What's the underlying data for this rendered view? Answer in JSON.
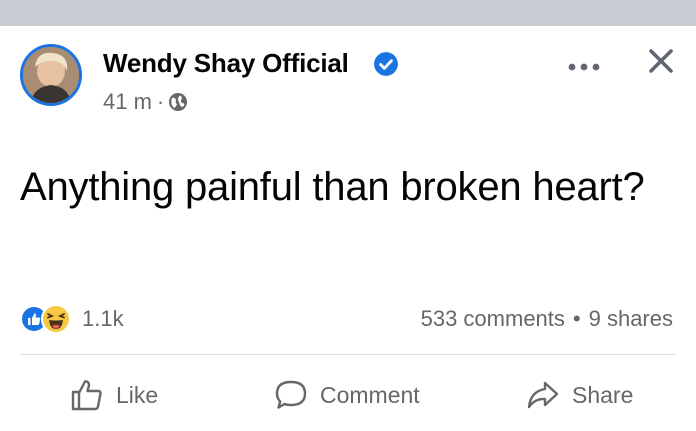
{
  "post": {
    "author": "Wendy Shay Official",
    "time": "41 m",
    "separator": "·",
    "text": "Anything painful than broken heart?",
    "reaction_count": "1.1k",
    "comments": "533 comments",
    "bullet": "•",
    "shares": "9 shares"
  },
  "actions": {
    "like": "Like",
    "comment": "Comment",
    "share": "Share"
  },
  "icons": {
    "verified": "verified-badge-icon",
    "privacy": "globe-icon",
    "more": "more-icon",
    "close": "close-icon",
    "like_reaction": "like-reaction-icon",
    "haha_reaction": "haha-reaction-icon"
  },
  "colors": {
    "accent": "#1b74e4",
    "secondary_text": "#65676b",
    "haha_yellow": "#f7c843"
  }
}
